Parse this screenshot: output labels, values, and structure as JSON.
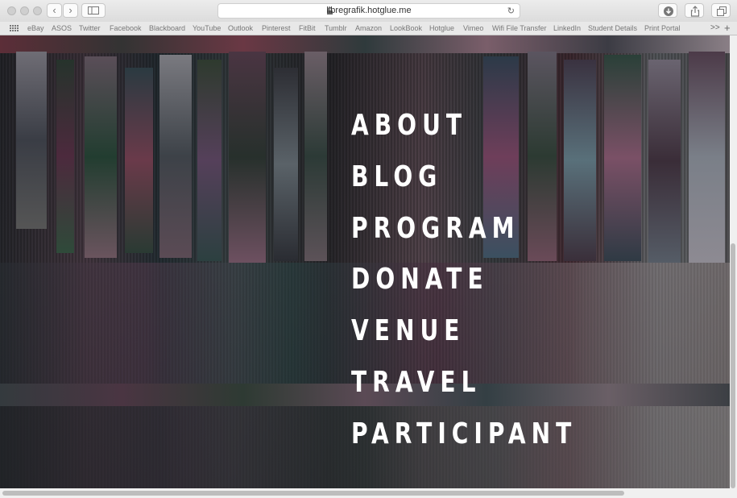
{
  "browser": {
    "url": "libregrafik.hotglue.me",
    "back_label": "‹",
    "forward_label": "›",
    "reload_label": "↻",
    "favorites": [
      "eBay",
      "ASOS",
      "Twitter",
      "Facebook",
      "Blackboard",
      "YouTube",
      "Outlook",
      "Pinterest",
      "FitBit",
      "Tumblr",
      "Amazon",
      "LookBook",
      "Hotglue",
      "Vimeo",
      "Wifi File Transfer",
      "LinkedIn",
      "Student Details",
      "Print Portal"
    ],
    "more_label": ">>",
    "new_tab_label": "+"
  },
  "menu": {
    "items": [
      "ABOUT",
      "BLOG",
      "PROGRAM",
      "DONATE",
      "VENUE",
      "TRAVEL",
      "PARTICIPANT"
    ]
  },
  "colors": {
    "menu_text": "#ffffff",
    "chrome_bg": "#e0e0e0"
  }
}
